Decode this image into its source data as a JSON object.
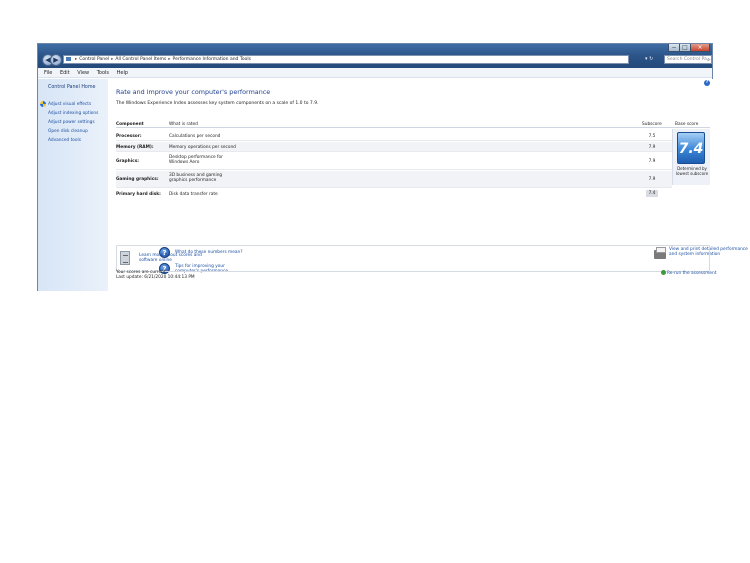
{
  "window": {
    "address": [
      "Control Panel",
      "All Control Panel Items",
      "Performance Information and Tools"
    ],
    "search_placeholder": "Search Control Pa...",
    "caption": {
      "minimize": "−",
      "maximize": "□",
      "close": "×"
    },
    "nav": {
      "back": "◀",
      "forward": "▶"
    },
    "addr_tools": "▾ ↻"
  },
  "menu": [
    "File",
    "Edit",
    "View",
    "Tools",
    "Help"
  ],
  "sidebar": {
    "home": "Control Panel Home",
    "items": [
      "Adjust visual effects",
      "Adjust indexing options",
      "Adjust power settings",
      "Open disk cleanup",
      "Advanced tools"
    ]
  },
  "main": {
    "help": "?",
    "heading": "Rate and improve your computer's performance",
    "description": "The Windows Experience Index assesses key system components on a scale of 1.0 to 7.9.",
    "table": {
      "headers": {
        "component": "Component",
        "what": "What is rated",
        "subscore": "Subscore",
        "base": "Base score"
      },
      "rows": [
        {
          "component": "Processor:",
          "what": "Calculations per second",
          "subscore": "7.5"
        },
        {
          "component": "Memory (RAM):",
          "what": "Memory operations per second",
          "subscore": "7.9"
        },
        {
          "component": "Graphics:",
          "what": "Desktop performance for Windows Aero",
          "subscore": "7.9"
        },
        {
          "component": "Gaming graphics:",
          "what": "3D business and gaming graphics performance",
          "subscore": "7.9"
        },
        {
          "component": "Primary hard disk:",
          "what": "Disk data transfer rate",
          "subscore": "7.4"
        }
      ],
      "base_score": "7.4",
      "base_caption": "Determined by lowest subscore"
    },
    "links": {
      "numbers": "What do these numbers mean?",
      "tips": "Tips for improving your computer's performance.",
      "details": "View and print detailed performance and system information",
      "learn": "Learn more about scores and software online"
    },
    "status": {
      "current": "Your scores are current",
      "updated": "Last update: 6/21/2020 10:44:13 PM"
    },
    "rerun": "Re-run the assessment"
  }
}
